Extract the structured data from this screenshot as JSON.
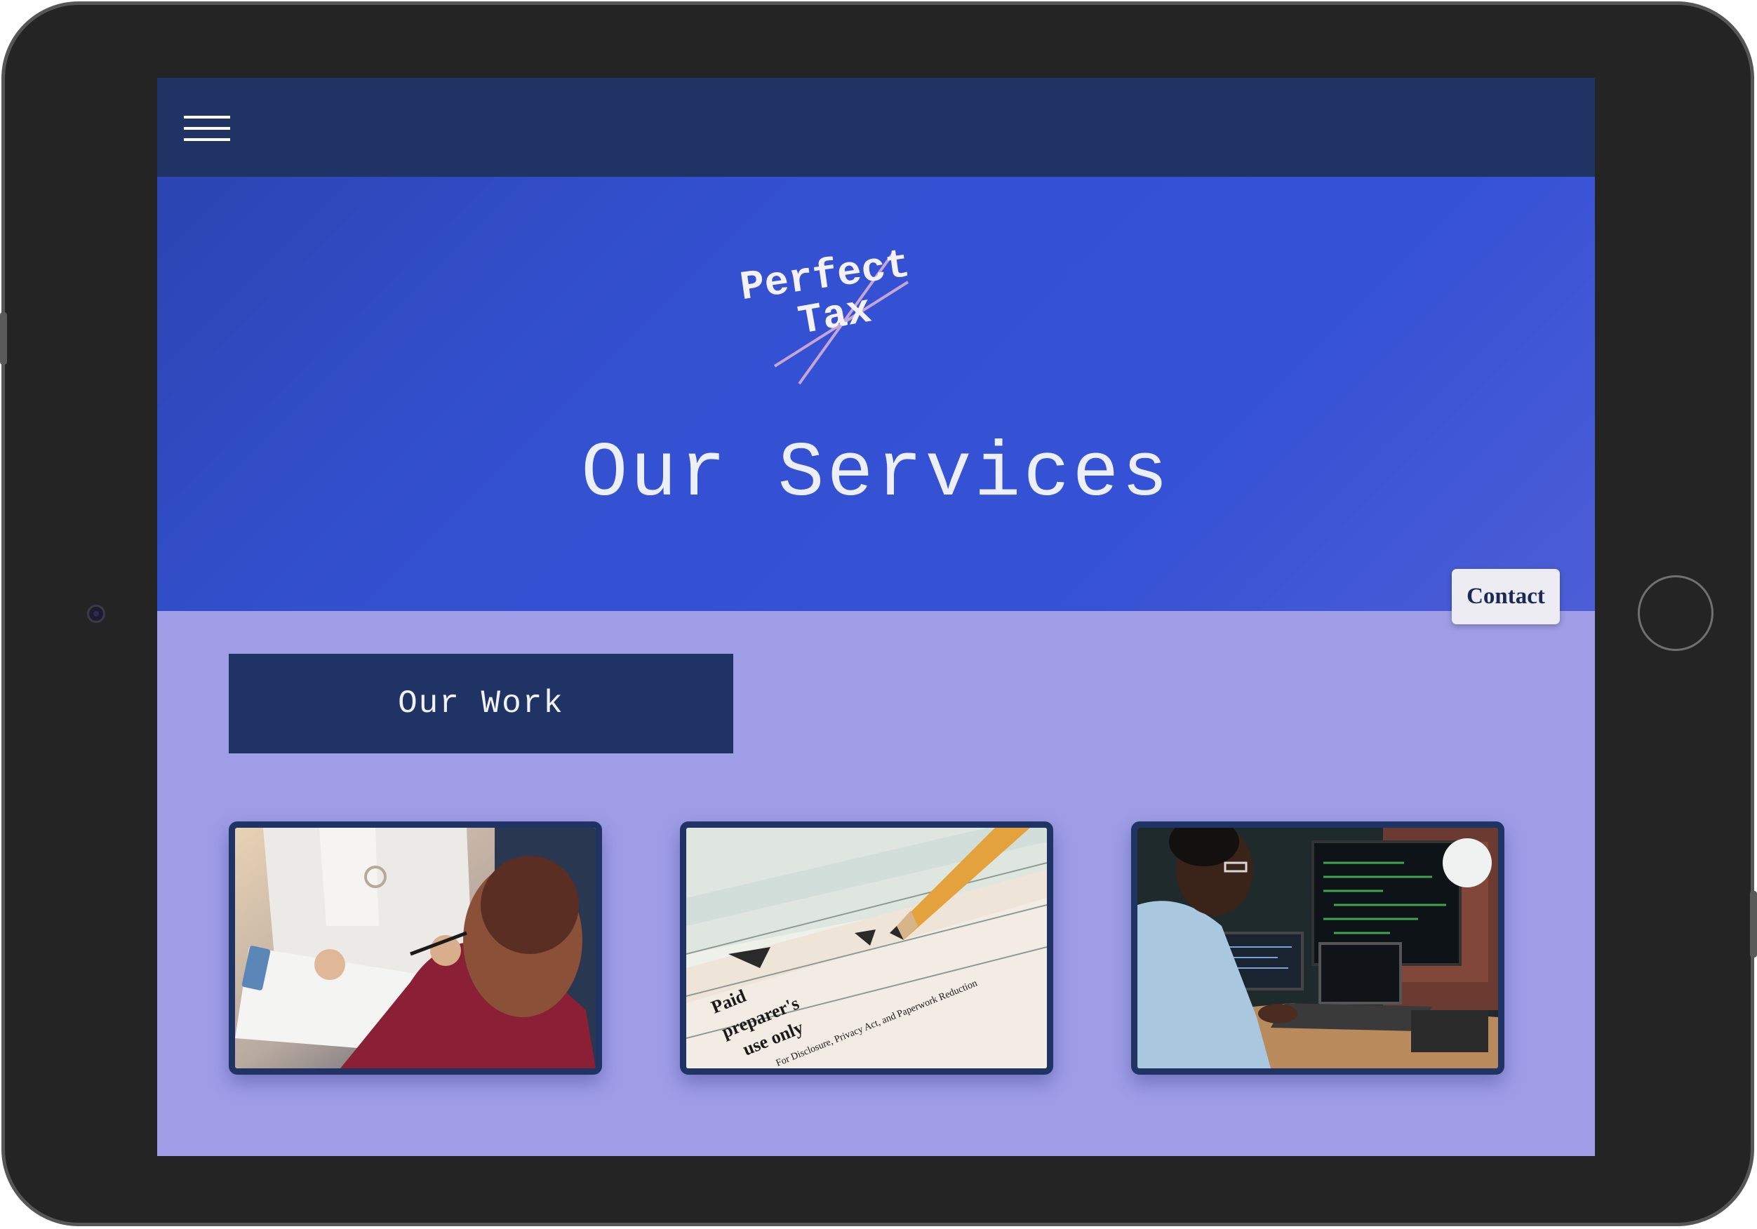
{
  "brand": {
    "logo_line1": "Perfect",
    "logo_line2": "Tax"
  },
  "nav": {
    "menu_icon": "hamburger-menu-icon"
  },
  "hero": {
    "title": "Our Services"
  },
  "contact": {
    "label": "Contact"
  },
  "section": {
    "heading": "Our Work"
  },
  "cards": [
    {
      "image": "doctor-patient-clipboard-photo"
    },
    {
      "image": "tax-form-pencil-photo",
      "visible_text": [
        "Paid",
        "preparer's",
        "use only",
        "For Disclosure, Privacy Act, and Paperwork Reduction"
      ]
    },
    {
      "image": "man-coding-laptop-photo"
    }
  ],
  "colors": {
    "navy": "#1f3464",
    "hero_blue": "#3551d5",
    "lavender": "#9e9de6",
    "logo_cross": "#c7a4d6"
  }
}
